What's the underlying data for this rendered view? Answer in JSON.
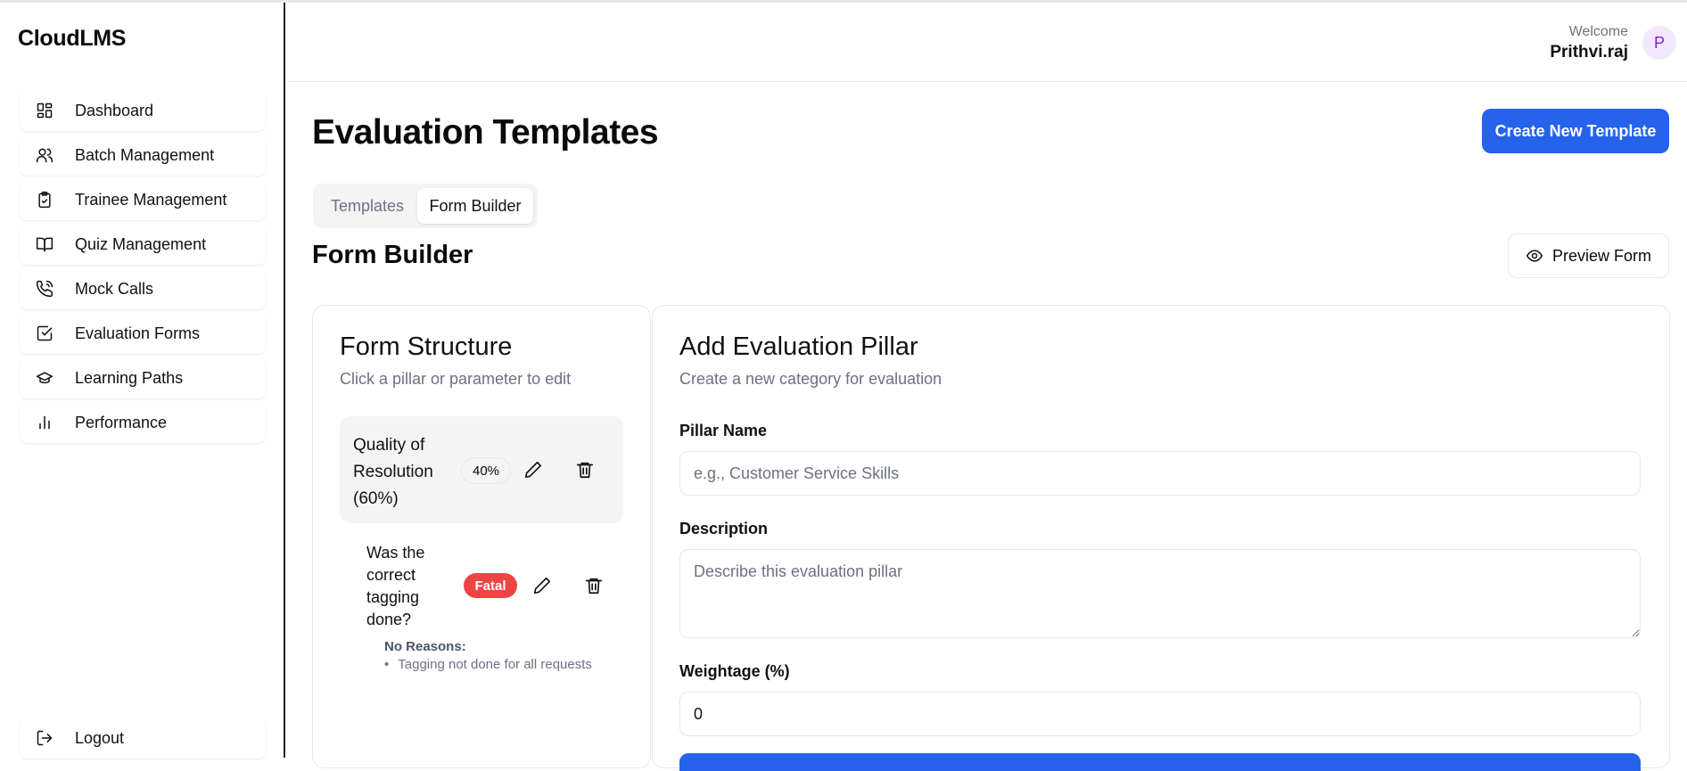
{
  "app": {
    "brand": "CloudLMS"
  },
  "sidebar": {
    "items": [
      {
        "label": "Dashboard",
        "icon": "dashboard-icon"
      },
      {
        "label": "Batch Management",
        "icon": "users-icon"
      },
      {
        "label": "Trainee Management",
        "icon": "clipboard-check-icon"
      },
      {
        "label": "Quiz Management",
        "icon": "book-open-icon"
      },
      {
        "label": "Mock Calls",
        "icon": "phone-call-icon"
      },
      {
        "label": "Evaluation Forms",
        "icon": "check-square-icon"
      },
      {
        "label": "Learning Paths",
        "icon": "graduation-cap-icon"
      },
      {
        "label": "Performance",
        "icon": "bar-chart-icon"
      }
    ],
    "logout": "Logout"
  },
  "header": {
    "welcome": "Welcome",
    "user_name": "Prithvi.raj",
    "avatar_initial": "P"
  },
  "page": {
    "title": "Evaluation Templates",
    "create_button": "Create New Template",
    "tabs": [
      {
        "label": "Templates",
        "active": false
      },
      {
        "label": "Form Builder",
        "active": true
      }
    ],
    "section_title": "Form Builder",
    "preview_button": "Preview Form"
  },
  "structure": {
    "title": "Form Structure",
    "subtitle": "Click a pillar or parameter to edit",
    "pillar": {
      "name": "Quality of Resolution (60%)",
      "badge": "40%"
    },
    "parameter": {
      "question": "Was the correct tagging done?",
      "badge": "Fatal",
      "reasons_label": "No Reasons:",
      "reasons": [
        "Tagging not done for all requests"
      ]
    }
  },
  "add_pillar": {
    "title": "Add Evaluation Pillar",
    "subtitle": "Create a new category for evaluation",
    "name_label": "Pillar Name",
    "name_placeholder": "e.g., Customer Service Skills",
    "description_label": "Description",
    "description_placeholder": "Describe this evaluation pillar",
    "weightage_label": "Weightage (%)",
    "weightage_value": "0"
  },
  "colors": {
    "primary": "#2563eb",
    "fatal": "#ef4444",
    "avatar_bg": "#f3e8ff",
    "avatar_fg": "#7e22ce"
  }
}
